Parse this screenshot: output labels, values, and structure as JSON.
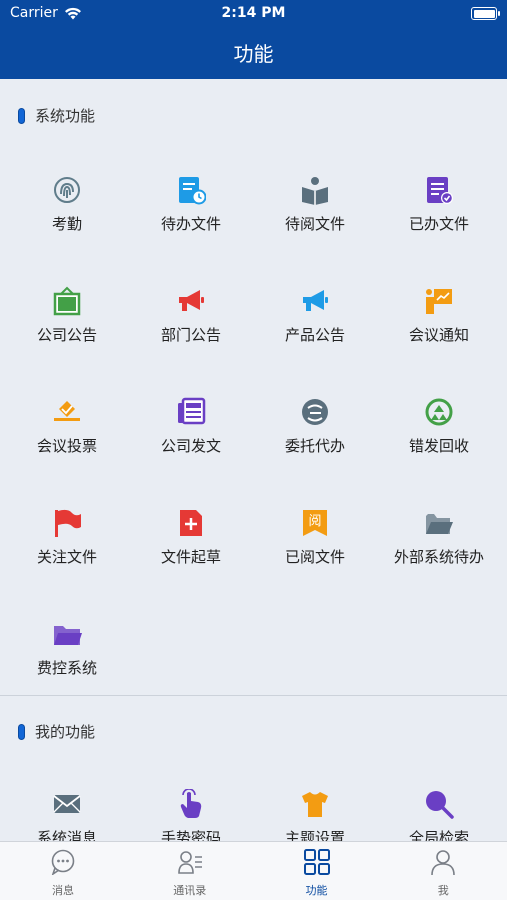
{
  "status": {
    "carrier": "Carrier",
    "time": "2:14 PM"
  },
  "header": {
    "title": "功能"
  },
  "system_section": {
    "title": "系统功能",
    "items": [
      {
        "label": "考勤",
        "icon": "fingerprint-icon",
        "color": "#607d8b"
      },
      {
        "label": "待办文件",
        "icon": "pending-file-icon",
        "color": "#1e9be6"
      },
      {
        "label": "待阅文件",
        "icon": "reading-book-icon",
        "color": "#5a6f7d"
      },
      {
        "label": "已办文件",
        "icon": "done-document-icon",
        "color": "#6a3fc4"
      },
      {
        "label": "公司公告",
        "icon": "notice-board-icon",
        "color": "#43a047"
      },
      {
        "label": "部门公告",
        "icon": "megaphone-icon",
        "color": "#e53935"
      },
      {
        "label": "产品公告",
        "icon": "megaphone-icon",
        "color": "#1e9be6"
      },
      {
        "label": "会议通知",
        "icon": "presentation-icon",
        "color": "#f39c12"
      },
      {
        "label": "会议投票",
        "icon": "ballot-icon",
        "color": "#f39c12"
      },
      {
        "label": "公司发文",
        "icon": "newspaper-icon",
        "color": "#6a3fc4"
      },
      {
        "label": "委托代办",
        "icon": "delegate-icon",
        "color": "#5a6f7d"
      },
      {
        "label": "错发回收",
        "icon": "recycle-icon",
        "color": "#43a047"
      },
      {
        "label": "关注文件",
        "icon": "flag-icon",
        "color": "#e53935"
      },
      {
        "label": "文件起草",
        "icon": "new-file-icon",
        "color": "#e53935"
      },
      {
        "label": "已阅文件",
        "icon": "read-mark-icon",
        "color": "#f39c12",
        "glyph": "阅"
      },
      {
        "label": "外部系统待办",
        "icon": "folder-open-icon",
        "color": "#5a6f7d"
      },
      {
        "label": "费控系统",
        "icon": "folder-icon",
        "color": "#6a3fc4"
      }
    ]
  },
  "my_section": {
    "title": "我的功能",
    "items": [
      {
        "label": "系统消息",
        "icon": "envelope-icon",
        "color": "#5a6f7d"
      },
      {
        "label": "手势密码",
        "icon": "gesture-icon",
        "color": "#6a3fc4"
      },
      {
        "label": "主题设置",
        "icon": "tshirt-icon",
        "color": "#f39c12"
      },
      {
        "label": "全局检索",
        "icon": "search-icon",
        "color": "#6a3fc4"
      }
    ]
  },
  "tabs": [
    {
      "label": "消息",
      "icon": "chat-icon",
      "active": false
    },
    {
      "label": "通讯录",
      "icon": "contacts-icon",
      "active": false
    },
    {
      "label": "功能",
      "icon": "grid-icon",
      "active": true
    },
    {
      "label": "我",
      "icon": "user-icon",
      "active": false
    }
  ],
  "colors": {
    "brand": "#0a4aa0",
    "background": "#e9edf3"
  }
}
